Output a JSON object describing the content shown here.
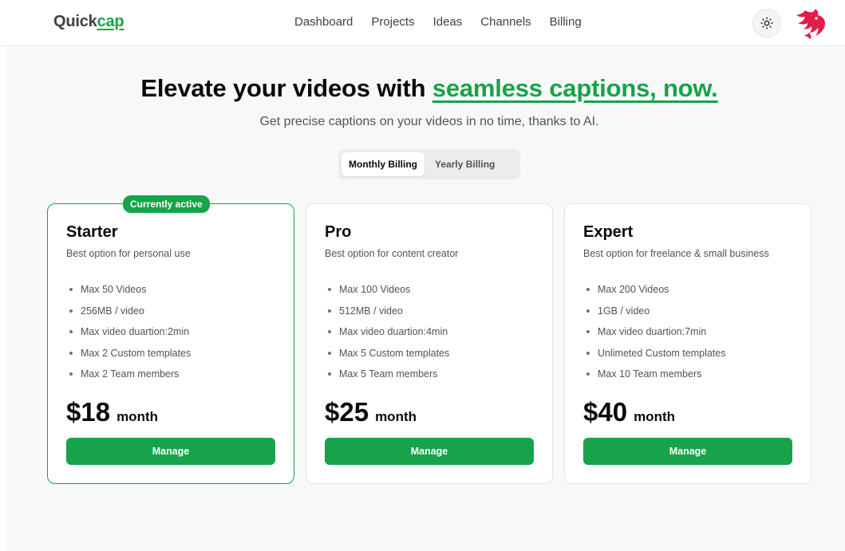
{
  "header": {
    "logo_main": "Quick",
    "logo_accent": "cap",
    "nav": [
      "Dashboard",
      "Projects",
      "Ideas",
      "Channels",
      "Billing"
    ],
    "theme_icon": "sun-icon",
    "avatar_icon": "red-creature-avatar"
  },
  "hero": {
    "title_plain": "Elevate your videos with ",
    "title_highlight": "seamless captions, now.",
    "subtitle": "Get precise captions on your videos in no time, thanks to AI."
  },
  "billing_toggle": {
    "monthly": "Monthly Billing",
    "yearly": "Yearly Billing",
    "selected": "monthly"
  },
  "plans": [
    {
      "badge": "Currently active",
      "name": "Starter",
      "description": "Best option for personal use",
      "features": [
        "Max 50 Videos",
        "256MB / video",
        "Max video duartion:2min",
        "Max 2 Custom templates",
        "Max 2 Team members"
      ],
      "price": "$18",
      "period": "month",
      "button": "Manage"
    },
    {
      "name": "Pro",
      "description": "Best option for content creator",
      "features": [
        "Max 100 Videos",
        "512MB / video",
        "Max video duartion:4min",
        "Max 5 Custom templates",
        "Max 5 Team members"
      ],
      "price": "$25",
      "period": "month",
      "button": "Manage"
    },
    {
      "name": "Expert",
      "description": "Best option for freelance & small business",
      "features": [
        "Max 200 Videos",
        "1GB / video",
        "Max video duartion:7min",
        "Unlimeted Custom templates",
        "Max 10 Team members"
      ],
      "price": "$40",
      "period": "month",
      "button": "Manage"
    }
  ],
  "colors": {
    "accent": "#16a34a",
    "page_bg": "#f8f8f8",
    "card_bg": "#ffffff",
    "avatar": "#e11d48"
  }
}
